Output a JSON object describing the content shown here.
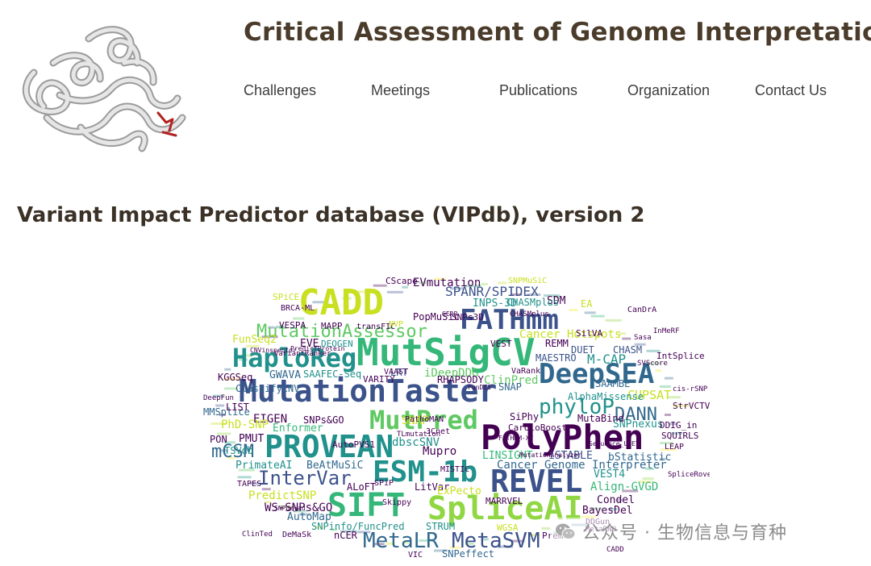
{
  "header": {
    "title": "Critical Assessment of Genome Interpretation",
    "logo_alt": "protein structure logo"
  },
  "nav": {
    "items": [
      {
        "label": "Challenges"
      },
      {
        "label": "Meetings"
      },
      {
        "label": "Publications"
      },
      {
        "label": "Organization"
      },
      {
        "label": "Contact Us"
      }
    ]
  },
  "main": {
    "heading": "Variant Impact Predictor database (VIPdb), version 2"
  },
  "wordcloud": {
    "palette": [
      "#440154",
      "#3b528b",
      "#21918c",
      "#5ec962",
      "#fde725",
      "#31688e",
      "#35b779",
      "#90d743",
      "#c8e020"
    ],
    "words": [
      {
        "text": "CADD",
        "color": "#c8e020"
      },
      {
        "text": "FATHmm",
        "color": "#3b528b"
      },
      {
        "text": "MutSigCV",
        "color": "#35b779"
      },
      {
        "text": "HaploReg",
        "color": "#21918c"
      },
      {
        "text": "MutationAssessor",
        "color": "#5ec962"
      },
      {
        "text": "DeepSEA",
        "color": "#31688e"
      },
      {
        "text": "MutationTaster",
        "color": "#3b528b"
      },
      {
        "text": "phyloP",
        "color": "#21918c"
      },
      {
        "text": "MutPred",
        "color": "#5ec962"
      },
      {
        "text": "PolyPhen",
        "color": "#440154"
      },
      {
        "text": "PROVEAN",
        "color": "#21918c"
      },
      {
        "text": "ESM-1b",
        "color": "#21918c"
      },
      {
        "text": "REVEL",
        "color": "#3b528b"
      },
      {
        "text": "InterVar",
        "color": "#3b528b"
      },
      {
        "text": "SIFT",
        "color": "#35b779"
      },
      {
        "text": "SpliceAI",
        "color": "#90d743"
      },
      {
        "text": "MetaLR",
        "color": "#31688e"
      },
      {
        "text": "MetaSVM",
        "color": "#3b528b"
      },
      {
        "text": "DANN",
        "color": "#31688e"
      },
      {
        "text": "mCSM",
        "color": "#31688e"
      },
      {
        "text": "SPANR/SPIDEX",
        "color": "#3b528b"
      },
      {
        "text": "EVmutation",
        "color": "#440154"
      },
      {
        "text": "SNAP",
        "color": "#c8e020"
      },
      {
        "text": "SDM",
        "color": "#440154"
      },
      {
        "text": "Cancer Hotspots",
        "color": "#c8e020"
      },
      {
        "text": "Cancer Genome Interpreter",
        "color": "#31688e"
      },
      {
        "text": "FunSeq2",
        "color": "#c8e020"
      },
      {
        "text": "EVE",
        "color": "#440154"
      },
      {
        "text": "DEOGEN",
        "color": "#21918c"
      },
      {
        "text": "REMM",
        "color": "#440154"
      },
      {
        "text": "DUET",
        "color": "#3b528b"
      },
      {
        "text": "CHASM",
        "color": "#3b528b"
      },
      {
        "text": "MAESTRO",
        "color": "#3b528b"
      },
      {
        "text": "M-CAP",
        "color": "#21918c"
      },
      {
        "text": "LRT",
        "color": "#3b528b"
      },
      {
        "text": "iDeepDDG",
        "color": "#5ec962"
      },
      {
        "text": "GWAVA",
        "color": "#31688e"
      },
      {
        "text": "SAAFEC-Seq",
        "color": "#21918c"
      },
      {
        "text": "ClinPred",
        "color": "#5ec962"
      },
      {
        "text": "CUPSAT",
        "color": "#c8e020"
      },
      {
        "text": "SAAMBE",
        "color": "#31688e"
      },
      {
        "text": "EIGEN",
        "color": "#440154"
      },
      {
        "text": "SNPs&GO",
        "color": "#440154"
      },
      {
        "text": "PhD-SNP",
        "color": "#c8e020"
      },
      {
        "text": "Enformer",
        "color": "#35b779"
      },
      {
        "text": "MMSplice",
        "color": "#31688e"
      },
      {
        "text": "PMUT",
        "color": "#440154"
      },
      {
        "text": "PON",
        "color": "#440154"
      },
      {
        "text": "SNPnexus",
        "color": "#21918c"
      },
      {
        "text": "MutaBind",
        "color": "#440154"
      },
      {
        "text": "DDIG_in",
        "color": "#440154"
      },
      {
        "text": "SQUIRLS",
        "color": "#440154"
      },
      {
        "text": "LINSIGHT",
        "color": "#35b779"
      },
      {
        "text": "iSTABLE",
        "color": "#3b528b"
      },
      {
        "text": "bStatistic",
        "color": "#31688e"
      },
      {
        "text": "Mupro",
        "color": "#440154"
      },
      {
        "text": "dbscSNV",
        "color": "#21918c"
      },
      {
        "text": "PrimateAI",
        "color": "#21918c"
      },
      {
        "text": "BeAtMuSiC",
        "color": "#31688e"
      },
      {
        "text": "PredictSNP",
        "color": "#c8e020"
      },
      {
        "text": "ALoFT",
        "color": "#440154"
      },
      {
        "text": "LitVar",
        "color": "#440154"
      },
      {
        "text": "ExPecto",
        "color": "#c8e020"
      },
      {
        "text": "VEST4",
        "color": "#21918c"
      },
      {
        "text": "Align-GVGD",
        "color": "#35b779"
      },
      {
        "text": "Condel",
        "color": "#440154"
      },
      {
        "text": "BayesDel",
        "color": "#440154"
      },
      {
        "text": "WS-SNPs&GO",
        "color": "#440154"
      },
      {
        "text": "AutoMap",
        "color": "#31688e"
      },
      {
        "text": "SNPinfo/FuncPred",
        "color": "#21918c"
      },
      {
        "text": "STRUM",
        "color": "#21918c"
      },
      {
        "text": "MARRVEL",
        "color": "#440154"
      },
      {
        "text": "nCER",
        "color": "#440154"
      },
      {
        "text": "WGSA",
        "color": "#c8e020"
      },
      {
        "text": "PremPS",
        "color": "#440154"
      },
      {
        "text": "SNPeffect",
        "color": "#31688e"
      },
      {
        "text": "VIC",
        "color": "#440154"
      },
      {
        "text": "PopMuSic",
        "color": "#440154"
      },
      {
        "text": "SNPs3D",
        "color": "#440154"
      },
      {
        "text": "INPS-3D",
        "color": "#21918c"
      },
      {
        "text": "CHASMplus",
        "color": "#21918c"
      },
      {
        "text": "VESPA",
        "color": "#440154"
      },
      {
        "text": "MAPP",
        "color": "#440154"
      },
      {
        "text": "transFIC",
        "color": "#440154"
      },
      {
        "text": "KGGSeq",
        "color": "#440154"
      },
      {
        "text": "ClassifyCNV",
        "color": "#31688e"
      },
      {
        "text": "LIST",
        "color": "#440154"
      },
      {
        "text": "TSVdb",
        "color": "#21918c"
      },
      {
        "text": "AutoPVS1",
        "color": "#440154"
      },
      {
        "text": "VARITY",
        "color": "#440154"
      },
      {
        "text": "RHAPSODY",
        "color": "#440154"
      },
      {
        "text": "AlphaMissense",
        "color": "#21918c"
      },
      {
        "text": "SiPhy",
        "color": "#440154"
      },
      {
        "text": "CardioBoost",
        "color": "#440154"
      },
      {
        "text": "SPiCE",
        "color": "#c8e020"
      },
      {
        "text": "CScape",
        "color": "#440154"
      },
      {
        "text": "SNPMuSiC",
        "color": "#c8e020"
      },
      {
        "text": "VEST",
        "color": "#440154"
      },
      {
        "text": "SilVA",
        "color": "#440154"
      },
      {
        "text": "IntSplice",
        "color": "#440154"
      },
      {
        "text": "StrVCTVRE",
        "color": "#440154"
      },
      {
        "text": "LEAP",
        "color": "#440154"
      },
      {
        "text": "CanDrA",
        "color": "#440154"
      },
      {
        "text": "EA",
        "color": "#c8e020"
      },
      {
        "text": "SNAP",
        "color": "#31688e"
      },
      {
        "text": "MISTIC",
        "color": "#440154"
      },
      {
        "text": "SPiP",
        "color": "#440154"
      },
      {
        "text": "Skippy",
        "color": "#440154"
      },
      {
        "text": "DeMaSk",
        "color": "#440154"
      },
      {
        "text": "TAPES",
        "color": "#440154"
      },
      {
        "text": "3Cnet",
        "color": "#440154"
      },
      {
        "text": "PathoMAN",
        "color": "#440154"
      },
      {
        "text": "VaRank",
        "color": "#440154"
      },
      {
        "text": "BRCA-ML",
        "color": "#440154"
      },
      {
        "text": "VAAST",
        "color": "#440154"
      },
      {
        "text": "DDGun",
        "color": "#440154"
      },
      {
        "text": "MetaRNN",
        "color": "#440154"
      },
      {
        "text": "DeepFun",
        "color": "#440154"
      },
      {
        "text": "NVP",
        "color": "#c8e020"
      },
      {
        "text": "CADD",
        "color": "#440154"
      },
      {
        "text": "SVScore",
        "color": "#440154"
      },
      {
        "text": "TLmutation",
        "color": "#440154"
      },
      {
        "text": "CHASMplus",
        "color": "#440154"
      },
      {
        "text": "SpliceRover",
        "color": "#440154"
      },
      {
        "text": "InMeRF",
        "color": "#440154"
      },
      {
        "text": "ClinTed",
        "color": "#440154"
      },
      {
        "text": "VariantRanker",
        "color": "#440154"
      },
      {
        "text": "FunDiS",
        "color": "#440154"
      },
      {
        "text": "Sasa",
        "color": "#440154"
      },
      {
        "text": "FATHMM-XF",
        "color": "#440154"
      },
      {
        "text": "SNPdryad",
        "color": "#440154"
      },
      {
        "text": "cis-rSNP",
        "color": "#440154"
      },
      {
        "text": "GERP",
        "color": "#440154"
      },
      {
        "text": "MutationAnalyzer",
        "color": "#440154"
      },
      {
        "text": "Sequence_UNET",
        "color": "#440154"
      },
      {
        "text": "PredictProtein",
        "color": "#440154"
      },
      {
        "text": "CNVinspector",
        "color": "#440154"
      },
      {
        "text": "SuSPect",
        "color": "#440154"
      },
      {
        "text": "PrediMod",
        "color": "#440154"
      }
    ]
  },
  "watermark": {
    "text": "公众号 · 生物信息与育种",
    "icon": "wechat-icon"
  }
}
